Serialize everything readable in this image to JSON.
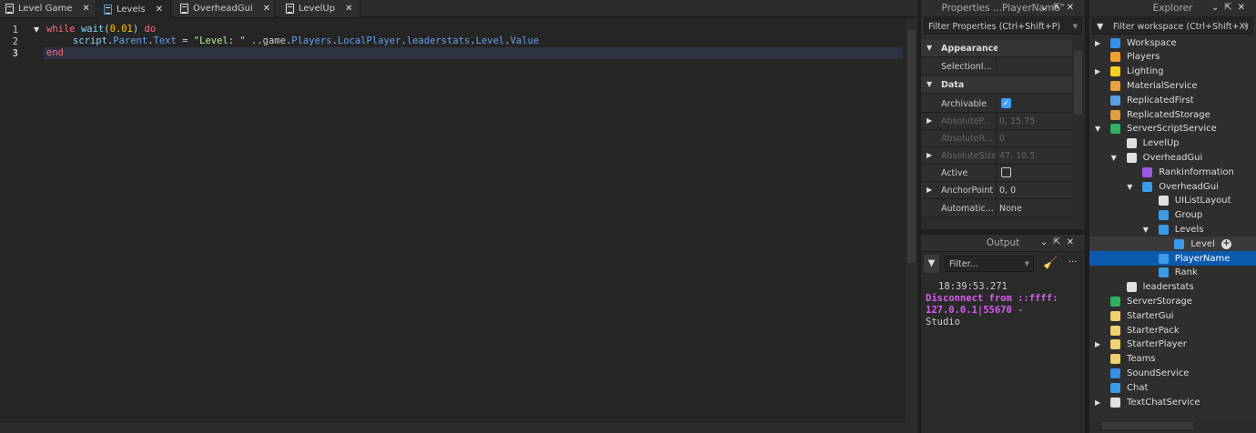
{
  "tabs": [
    {
      "label": "Level Game",
      "icon": "local-script-icon"
    },
    {
      "label": "Levels",
      "icon": "local-script-icon"
    },
    {
      "label": "OverheadGui",
      "icon": "script-icon"
    },
    {
      "label": "LevelUp",
      "icon": "script-icon"
    }
  ],
  "active_tab": 1,
  "editor": {
    "line_numbers": [
      "1",
      "2",
      "3"
    ],
    "line1": {
      "kw1": "while",
      "fn": "wait",
      "open": "(",
      "num": "0.01",
      "close": ")",
      "kw2": "do"
    },
    "line2": {
      "a": "script",
      "b": ".",
      "c": "Parent",
      "d": ".",
      "e": "Text",
      "f": " = ",
      "g": "\"Level: \"",
      "h": " ..game.",
      "i": "Players",
      "j": ".",
      "k": "LocalPlayer",
      "l": ".",
      "m": "leaderstats",
      "n": ".",
      "o": "Level",
      "p": ".",
      "q": "Value"
    },
    "line3": {
      "kw": "end"
    }
  },
  "properties": {
    "title": "Properties ...PlayerName\"",
    "filter_placeholder": "Filter Properties (Ctrl+Shift+P)",
    "rows": [
      {
        "type": "cat",
        "name": "Appearance"
      },
      {
        "name": "SelectionI...",
        "value": ""
      },
      {
        "type": "cat",
        "name": "Data"
      },
      {
        "name": "Archivable",
        "checkbox": true
      },
      {
        "name": "AbsoluteP...",
        "value": "0, 15.75",
        "disabled": true,
        "expand": true
      },
      {
        "name": "AbsoluteR...",
        "value": "0",
        "disabled": true
      },
      {
        "name": "AbsoluteSize",
        "value": "47, 10.5",
        "disabled": true,
        "expand": true
      },
      {
        "name": "Active",
        "checkbox": false
      },
      {
        "name": "AnchorPoint",
        "value": "0, 0",
        "expand": true
      },
      {
        "name": "Automatic...",
        "value": "None"
      }
    ]
  },
  "output": {
    "title": "Output",
    "filter_placeholder": "Filter...",
    "more": "···",
    "timestamp": "18:39:53.271",
    "message1": "Disconnect from ::ffff:",
    "message2": "127.0.0.1|55670",
    "message3": " -",
    "message4": "Studio"
  },
  "explorer": {
    "title": "Explorer",
    "filter_placeholder": "Filter workspace (Ctrl+Shift+X)",
    "items": [
      {
        "label": "Workspace",
        "depth": 0,
        "arrow": "right",
        "color": "#3a8ee6"
      },
      {
        "label": "Players",
        "depth": 0,
        "color": "#f0a030"
      },
      {
        "label": "Lighting",
        "depth": 0,
        "arrow": "right",
        "color": "#f5d020"
      },
      {
        "label": "MaterialService",
        "depth": 0,
        "color": "#e8a040"
      },
      {
        "label": "ReplicatedFirst",
        "depth": 0,
        "color": "#5aa0e0"
      },
      {
        "label": "ReplicatedStorage",
        "depth": 0,
        "color": "#e0a040"
      },
      {
        "label": "ServerScriptService",
        "depth": 0,
        "arrow": "down",
        "color": "#30b060"
      },
      {
        "label": "LevelUp",
        "depth": 1,
        "color": "#e0e0e0"
      },
      {
        "label": "OverheadGui",
        "depth": 1,
        "arrow": "down",
        "color": "#e0e0e0"
      },
      {
        "label": "Rankinformation",
        "depth": 2,
        "color": "#9b59e6"
      },
      {
        "label": "OverheadGui",
        "depth": 2,
        "arrow": "down",
        "color": "#3a9be6"
      },
      {
        "label": "UIListLayout",
        "depth": 3,
        "color": "#e0e0e0"
      },
      {
        "label": "Group",
        "depth": 3,
        "color": "#3a9be6"
      },
      {
        "label": "Levels",
        "depth": 3,
        "arrow": "down",
        "color": "#3a9be6"
      },
      {
        "label": "Level",
        "depth": 4,
        "color": "#3a9be6",
        "state": "hover",
        "add": "+"
      },
      {
        "label": "PlayerName",
        "depth": 3,
        "color": "#3a9be6",
        "state": "selected"
      },
      {
        "label": "Rank",
        "depth": 3,
        "color": "#3a9be6"
      },
      {
        "label": "leaderstats",
        "depth": 1,
        "color": "#e0e0e0"
      },
      {
        "label": "ServerStorage",
        "depth": 0,
        "color": "#30b060"
      },
      {
        "label": "StarterGui",
        "depth": 0,
        "color": "#f0d070"
      },
      {
        "label": "StarterPack",
        "depth": 0,
        "color": "#f0d070"
      },
      {
        "label": "StarterPlayer",
        "depth": 0,
        "arrow": "right",
        "color": "#f0d070"
      },
      {
        "label": "Teams",
        "depth": 0,
        "color": "#f0d070"
      },
      {
        "label": "SoundService",
        "depth": 0,
        "color": "#3a8ee6"
      },
      {
        "label": "Chat",
        "depth": 0,
        "color": "#3a9be6"
      },
      {
        "label": "TextChatService",
        "depth": 0,
        "arrow": "right",
        "color": "#e0e0e0"
      }
    ]
  }
}
